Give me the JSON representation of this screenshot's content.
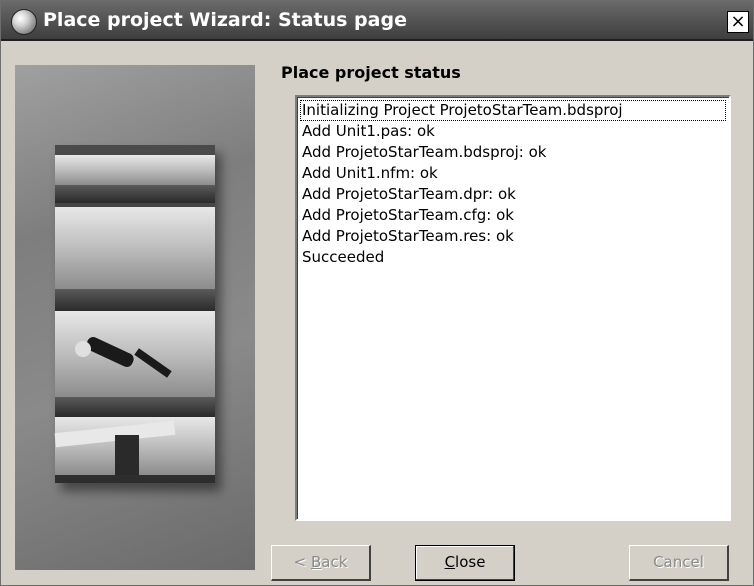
{
  "window": {
    "title": "Place project Wizard: Status page",
    "close_glyph": "×",
    "app_icon": "wizard-globe-icon"
  },
  "page": {
    "heading": "Place project status"
  },
  "status_lines": [
    "Initializing Project ProjetoStarTeam.bdsproj",
    "Add Unit1.pas: ok",
    "Add ProjetoStarTeam.bdsproj: ok",
    "Add Unit1.nfm: ok",
    "Add ProjetoStarTeam.dpr: ok",
    "Add ProjetoStarTeam.cfg: ok",
    "Add ProjetoStarTeam.res: ok",
    "Succeeded"
  ],
  "buttons": {
    "back_prefix": "< ",
    "back_mnemonic": "B",
    "back_rest": "ack",
    "close_mnemonic": "C",
    "close_rest": "lose",
    "cancel": "Cancel"
  },
  "colors": {
    "titlebar": "#4a4a4a",
    "dialog_bg": "#d4d0c8"
  }
}
